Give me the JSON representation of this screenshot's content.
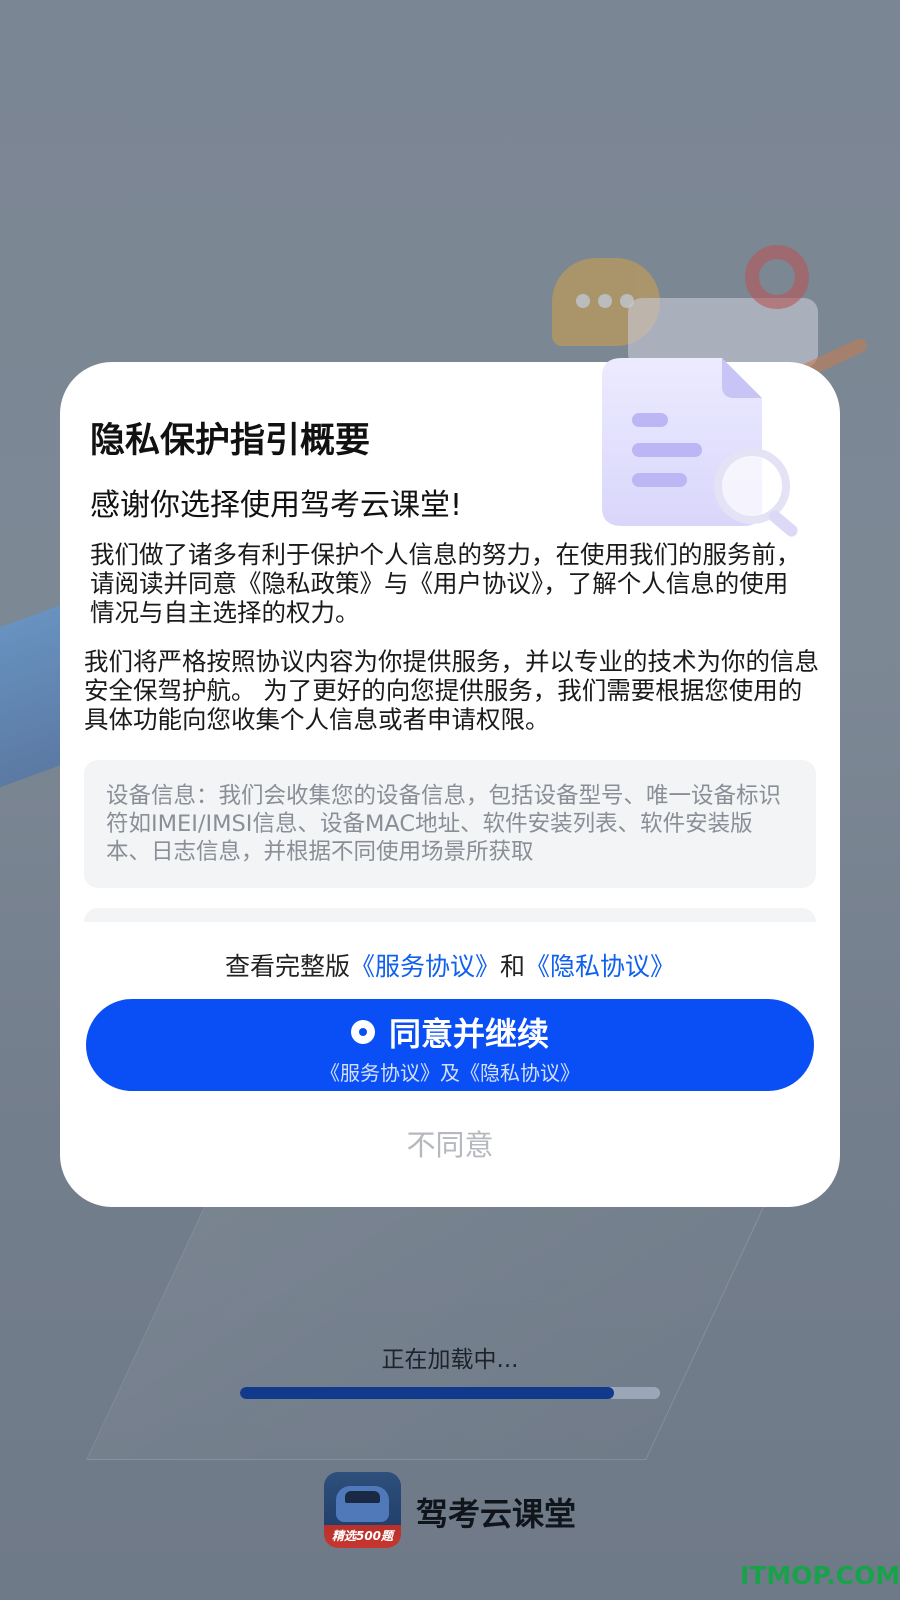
{
  "dialog": {
    "title": "隐私保护指引概要",
    "subtitle": "感谢你选择使用驾考云课堂!",
    "paragraph_1": "我们做了诸多有利于保护个人信息的努力，在使用我们的服务前，请阅读并同意《隐私政策》与《用户协议》，了解个人信息的使用情况与自主选择的权力。",
    "paragraph_2": "我们将严格按照协议内容为你提供服务，并以专业的技术为你的信息安全保驾护航。 为了更好的向您提供服务，我们需要根据您使用的具体功能向您收集个人信息或者申请权限。",
    "device_info": "设备信息：我们会收集您的设备信息，包括设备型号、唯一设备标识符如IMEI/IMSI信息、设备MAC地址、软件安装列表、软件安装版本、日志信息，并根据不同使用场景所获取",
    "links": {
      "prefix": "查看完整版",
      "service_agreement": "《服务协议》",
      "conjunction": "和",
      "privacy_agreement": "《隐私协议》"
    },
    "agree_button": {
      "label": "同意并继续",
      "sublabel": "《服务协议》及《隐私协议》",
      "icon": "radio-dot-icon"
    },
    "disagree_label": "不同意"
  },
  "loading": {
    "text": "正在加载中...",
    "progress": 0.89
  },
  "brand": {
    "app_name": "驾考云课堂",
    "icon_label": "精选500题"
  },
  "watermark": "ITMOP.COM",
  "colors": {
    "primary_button": "#0a4ef5",
    "link": "#1060f0",
    "progress_fill": "#123a8c",
    "watermark": "#18a34a"
  }
}
